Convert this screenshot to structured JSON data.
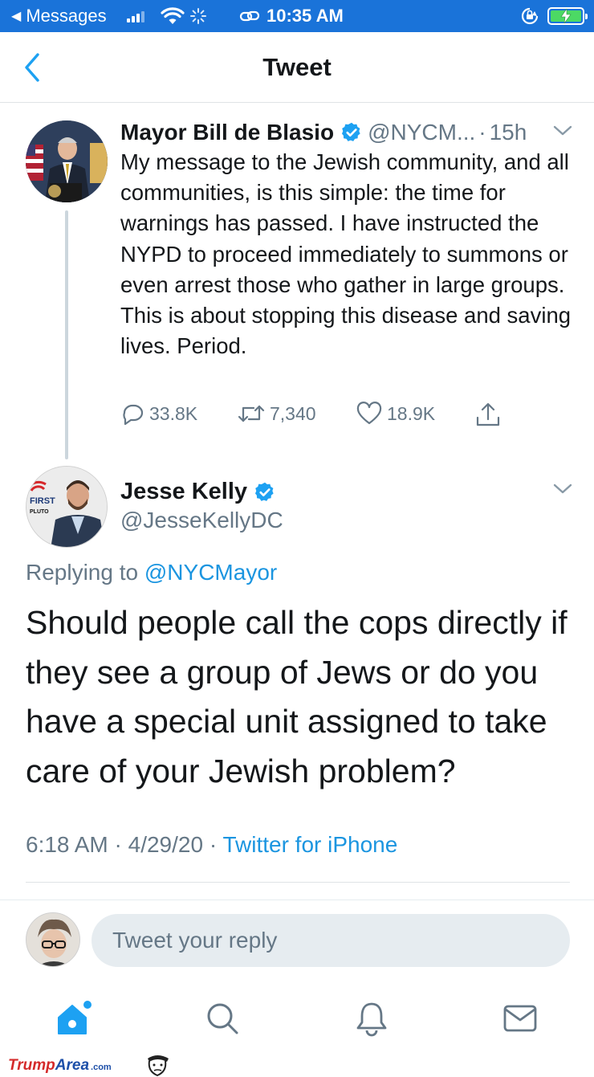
{
  "status_bar": {
    "back_app": "Messages",
    "time": "10:35 AM",
    "battery_color": "#4cd964",
    "bar_color": "#1a73d9"
  },
  "nav": {
    "title": "Tweet",
    "back_icon": "chevron-left-icon"
  },
  "parent_tweet": {
    "author_name": "Mayor Bill de Blasio",
    "handle": "@NYCM...",
    "separator": "·",
    "time": "15h",
    "text": "My message to the Jewish community, and all communities, is this simple: the time for warnings has passed. I have instructed the NYPD to proceed immediately to summons or even arrest those who gather in large groups. This is about stopping this disease and saving lives. Period.",
    "reply_count": "33.8K",
    "retweet_count": "7,340",
    "like_count": "18.9K"
  },
  "reply_tweet": {
    "author_name": "Jesse Kelly",
    "handle": "@JesseKellyDC",
    "replying_prefix": "Replying to",
    "replying_to": "@NYCMayor",
    "text": "Should people call the cops directly if they see a group of Jews or do you have a special unit assigned to take care of your Jewish problem?",
    "time": "6:18 AM",
    "date": "4/29/20",
    "separator": "·",
    "source": "Twitter for iPhone",
    "avatar_badge_lines": [
      "FIRST",
      "PLUTO"
    ]
  },
  "reply_box": {
    "placeholder": "Tweet your reply"
  },
  "tab_bar": {
    "tabs": [
      "home-icon",
      "search-icon",
      "bell-icon",
      "mail-icon"
    ],
    "active_color": "#1da1f2",
    "inactive_color": "#657786"
  },
  "watermark": {
    "part1": "Trump",
    "part2": "Area",
    "part3": ".com"
  },
  "colors": {
    "link": "#1b95e0",
    "secondary": "#657786",
    "primary_text": "#14171a",
    "verified": "#1da1f2"
  }
}
